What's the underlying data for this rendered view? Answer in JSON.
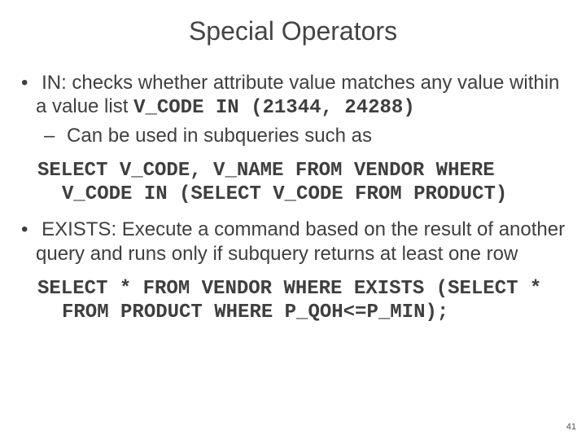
{
  "title": "Special Operators",
  "bullets": [
    {
      "text_pre": "IN: checks whether attribute value matches any value within a value list  ",
      "code_inline": "V_CODE IN (21344, 24288)",
      "sub": [
        {
          "text": "Can be used in subqueries such as"
        }
      ],
      "code_block": "SELECT V_CODE, V_NAME FROM VENDOR WHERE V_CODE IN (SELECT V_CODE FROM PRODUCT)"
    },
    {
      "text_pre": "EXISTS: Execute a command based on the result of another query and runs only if subquery returns at least one row",
      "code_inline": "",
      "sub": [],
      "code_block": "SELECT * FROM VENDOR WHERE EXISTS (SELECT * FROM PRODUCT WHERE P_QOH<=P_MIN);"
    }
  ],
  "page_number": "41"
}
